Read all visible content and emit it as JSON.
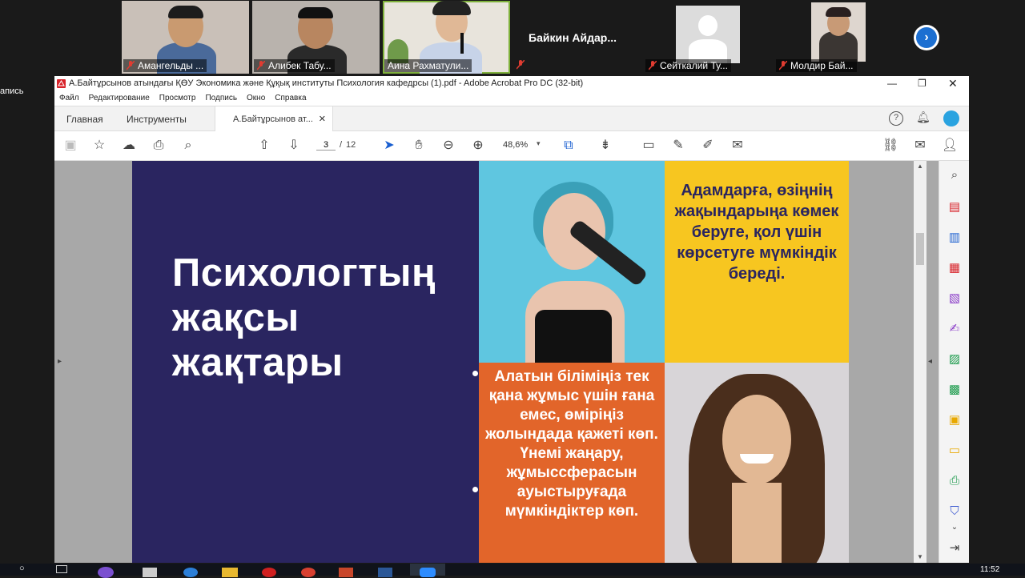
{
  "meeting": {
    "participants": [
      {
        "name": "Амангельды ..."
      },
      {
        "name": "Алибек Табу..."
      },
      {
        "name": "Аина Рахматули..."
      },
      {
        "name": "Байкин  Айдар..."
      },
      {
        "name": "Сейткалий Ту..."
      },
      {
        "name": "Молдир Бай..."
      }
    ],
    "side_label": "апись",
    "next_icon": "chevron-right-icon"
  },
  "acrobat": {
    "title": "А.Байтұрсынов атындағы ҚӨУ Экономика және Құқық институты Психология кафедрсы (1).pdf - Adobe Acrobat Pro DC (32-bit)",
    "menu": [
      "Файл",
      "Редактирование",
      "Просмотр",
      "Подпись",
      "Окно",
      "Справка"
    ],
    "tabs": {
      "home": "Главная",
      "tools": "Инструменты",
      "document": "А.Байтұрсынов ат..."
    },
    "page_current": "3",
    "page_sep": "/",
    "page_total": "12",
    "zoom": "48,6%"
  },
  "slide": {
    "title_line1": "Психологтың",
    "title_line2": "жақсы",
    "title_line3": "жақтары",
    "box_yellow": "Адамдарға, өзіңнің жақындарыңа көмек беруге, қол үшін көрсетуге мүмкіндік береді.",
    "box_orange_1": "Алатын біліміңіз тек қана жұмыс үшін ғана емес, өміріңіз жолындада қажеті көп.",
    "box_orange_2": "Үнемі  жаңару, жұмыссферасын ауыстыруғада мүмкіндіктер көп.",
    "colors": {
      "navy": "#2a2560",
      "cyan": "#5fc6e0",
      "yellow": "#f7c620",
      "orange": "#e2652a",
      "photo_bg": "#d8d5d8"
    }
  },
  "taskbar": {
    "time": "11:52"
  }
}
